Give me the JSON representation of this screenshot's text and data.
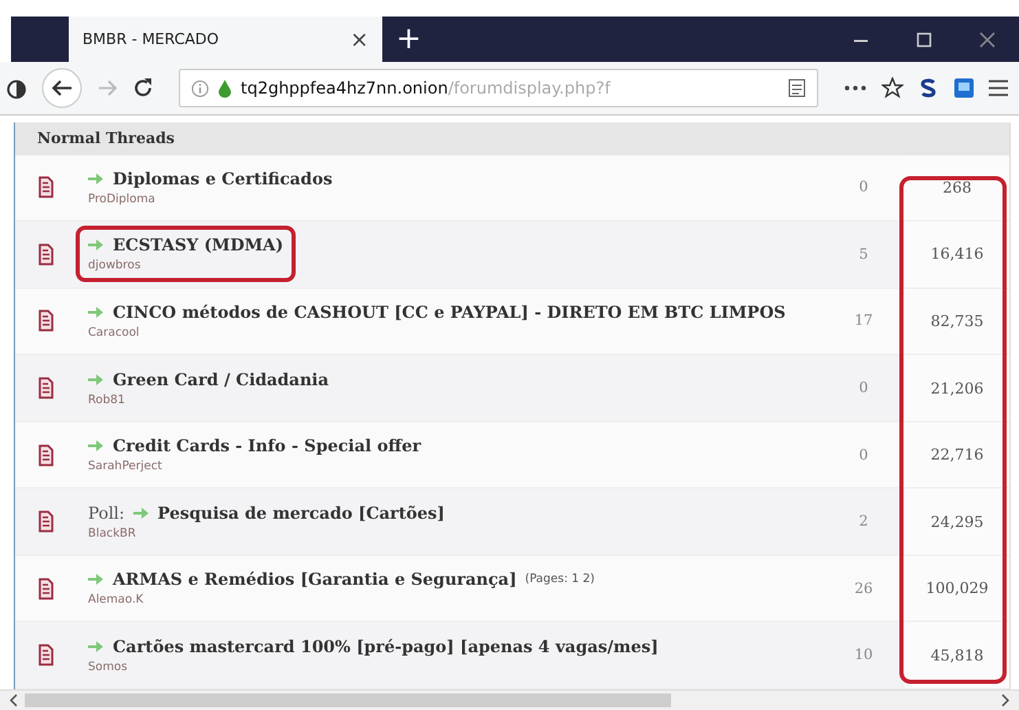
{
  "browser": {
    "tab_title": "BMBR - MERCADO",
    "tab_close": "×",
    "new_tab": "+",
    "url_host": "tq2ghppfea4hz7nn.onion",
    "url_path": "/forumdisplay.php?f"
  },
  "section_title": "Normal Threads",
  "views_highlighted": true,
  "threads": [
    {
      "title": "Diplomas e Certificados",
      "author": "ProDiploma",
      "replies": "0",
      "views": "268",
      "highlighted": false
    },
    {
      "title": "ECSTASY (MDMA)",
      "author": "djowbros",
      "replies": "5",
      "views": "16,416",
      "highlighted": true
    },
    {
      "title": "CINCO métodos de CASHOUT [CC e PAYPAL] - DIRETO EM BTC LIMPOS",
      "author": "Caracool",
      "replies": "17",
      "views": "82,735",
      "highlighted": false
    },
    {
      "title": "Green Card / Cidadania",
      "author": "Rob81",
      "replies": "0",
      "views": "21,206",
      "highlighted": false
    },
    {
      "title": "Credit Cards - Info - Special offer",
      "author": "SarahPerject",
      "replies": "0",
      "views": "22,716",
      "highlighted": false
    },
    {
      "prefix": "Poll:",
      "title": "Pesquisa de mercado [Cartões]",
      "author": "BlackBR",
      "replies": "2",
      "views": "24,295",
      "highlighted": false
    },
    {
      "title": "ARMAS e Remédios [Garantia e Segurança]",
      "pages": "(Pages: 1 2)",
      "author": "Alemao.K",
      "replies": "26",
      "views": "100,029",
      "highlighted": false
    },
    {
      "title": "Cartões mastercard 100% [pré-pago] [apenas 4 vagas/mes]",
      "author": "Somos",
      "replies": "10",
      "views": "45,818",
      "highlighted": false
    }
  ]
}
